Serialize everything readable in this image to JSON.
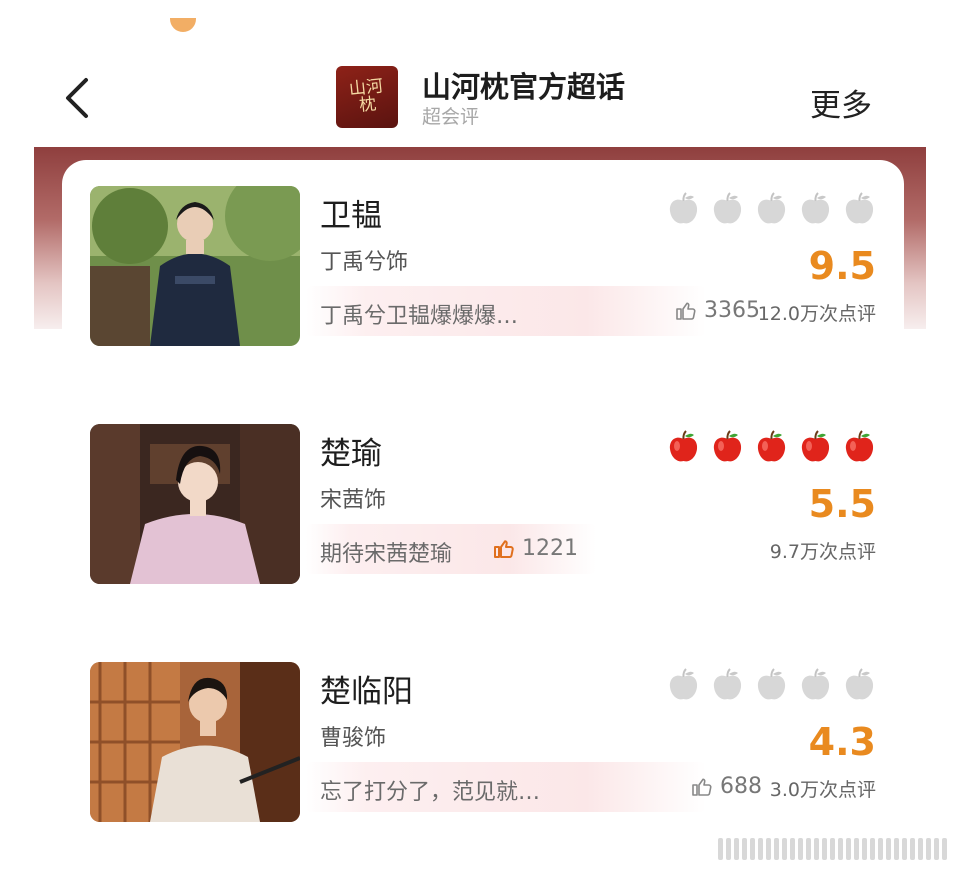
{
  "header": {
    "title": "山河枕官方超话",
    "subtitle": "超会评",
    "more_label": "更多",
    "logo_text": "山河枕"
  },
  "colors": {
    "score": "#e98a1f",
    "apple_active": "#e0241b",
    "apple_inactive": "#d7d7d7",
    "banner": "#8f3f3e"
  },
  "ratings": [
    {
      "name": "卫韫",
      "actor": "丁禹兮饰",
      "comment": "丁禹兮卫韫爆爆爆…",
      "likes": "3365",
      "score": "9.5",
      "review_count": "12.0万次点评",
      "apples_active": false
    },
    {
      "name": "楚瑜",
      "actor": "宋茜饰",
      "comment": "期待宋茜楚瑜",
      "likes": "1221",
      "score": "5.5",
      "review_count": "9.7万次点评",
      "apples_active": true
    },
    {
      "name": "楚临阳",
      "actor": "曹骏饰",
      "comment": "忘了打分了，范见就…",
      "likes": "688",
      "score": "4.3",
      "review_count": "3.0万次点评",
      "apples_active": false
    }
  ]
}
